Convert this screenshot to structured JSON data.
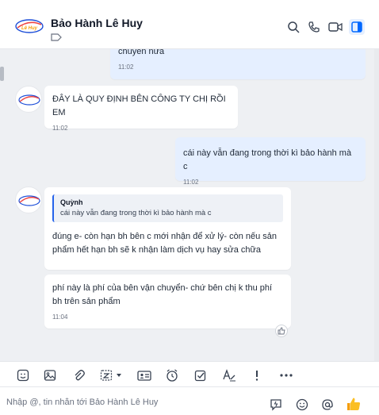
{
  "header": {
    "contact_name": "Bảo Hành Lê Huy",
    "logo_text": "Lê Huy",
    "icons": [
      "search-icon",
      "phone-icon",
      "video-icon",
      "sidebar-toggle-icon"
    ]
  },
  "messages": [
    {
      "id": "m0",
      "direction": "outgoing",
      "text": "chuyển nữa",
      "time": "11:02"
    },
    {
      "id": "m1",
      "direction": "incoming",
      "text": "ĐÂY LÀ QUY ĐỊNH BÊN CÔNG TY CHỊ RỒI EM",
      "time": "11:02"
    },
    {
      "id": "m2",
      "direction": "outgoing",
      "text": "cái này vẫn đang trong thời kì bảo hành mà c",
      "time": "11:02"
    },
    {
      "id": "m3",
      "direction": "incoming",
      "quote": {
        "name": "Quỳnh",
        "text": "cái này vẫn đang trong thời kì bảo hành mà c"
      },
      "text": "đúng e- còn hạn bh bên c mới nhận để xử lý- còn nếu sản phẩm hết hạn bh sẽ k nhận làm dịch vụ hay sửa chữa"
    },
    {
      "id": "m4",
      "direction": "incoming",
      "text": "phí này là phí của bên vận chuyển- chứ bên chị k thu phí bh trên sản phẩm",
      "time": "11:04",
      "reaction": "like-icon"
    }
  ],
  "toolbar": {
    "icons": [
      "sticker-icon",
      "image-icon",
      "attachment-icon",
      "screenshot-icon",
      "contact-card-icon",
      "reminder-icon",
      "task-icon",
      "text-format-icon",
      "urgent-icon",
      "more-icon"
    ]
  },
  "composer": {
    "placeholder": "Nhập @, tin nhắn tới Bảo Hành Lê Huy",
    "icons": [
      "quick-message-icon",
      "emoji-icon",
      "mention-icon",
      "thumbs-up-icon"
    ]
  },
  "colors": {
    "outgoing_bubble": "#e5efff",
    "incoming_bubble": "#ffffff",
    "accent": "#0068ff",
    "chat_background": "#eef0f3"
  }
}
